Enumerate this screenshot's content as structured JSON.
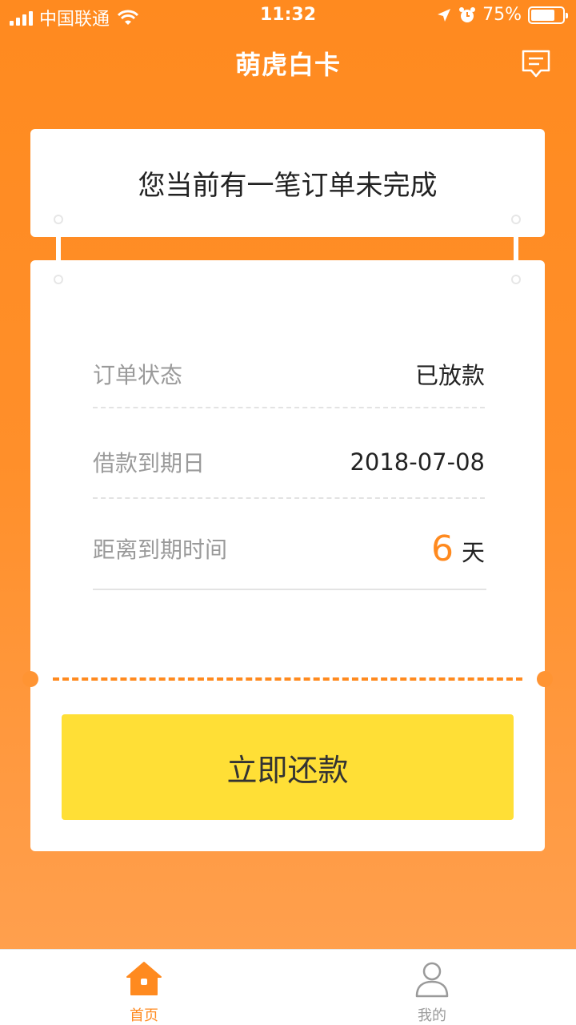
{
  "status_bar": {
    "carrier": "中国联通",
    "time": "11:32",
    "battery": "75%",
    "battery_level": 0.75
  },
  "header": {
    "title": "萌虎白卡",
    "message_icon": "message-icon"
  },
  "notice": {
    "text": "您当前有一笔订单未完成"
  },
  "order": {
    "status_label": "订单状态",
    "status_value": "已放款",
    "due_date_label": "借款到期日",
    "due_date_value": "2018-07-08",
    "remaining_label": "距离到期时间",
    "remaining_days": "6",
    "remaining_unit": "天"
  },
  "repay_button": {
    "label": "立即还款"
  },
  "tabs": [
    {
      "label": "首页",
      "icon": "home-icon",
      "active": true
    },
    {
      "label": "我的",
      "icon": "user-icon",
      "active": false
    }
  ],
  "colors": {
    "accent": "#ff8a1f",
    "button": "#ffdf36"
  }
}
